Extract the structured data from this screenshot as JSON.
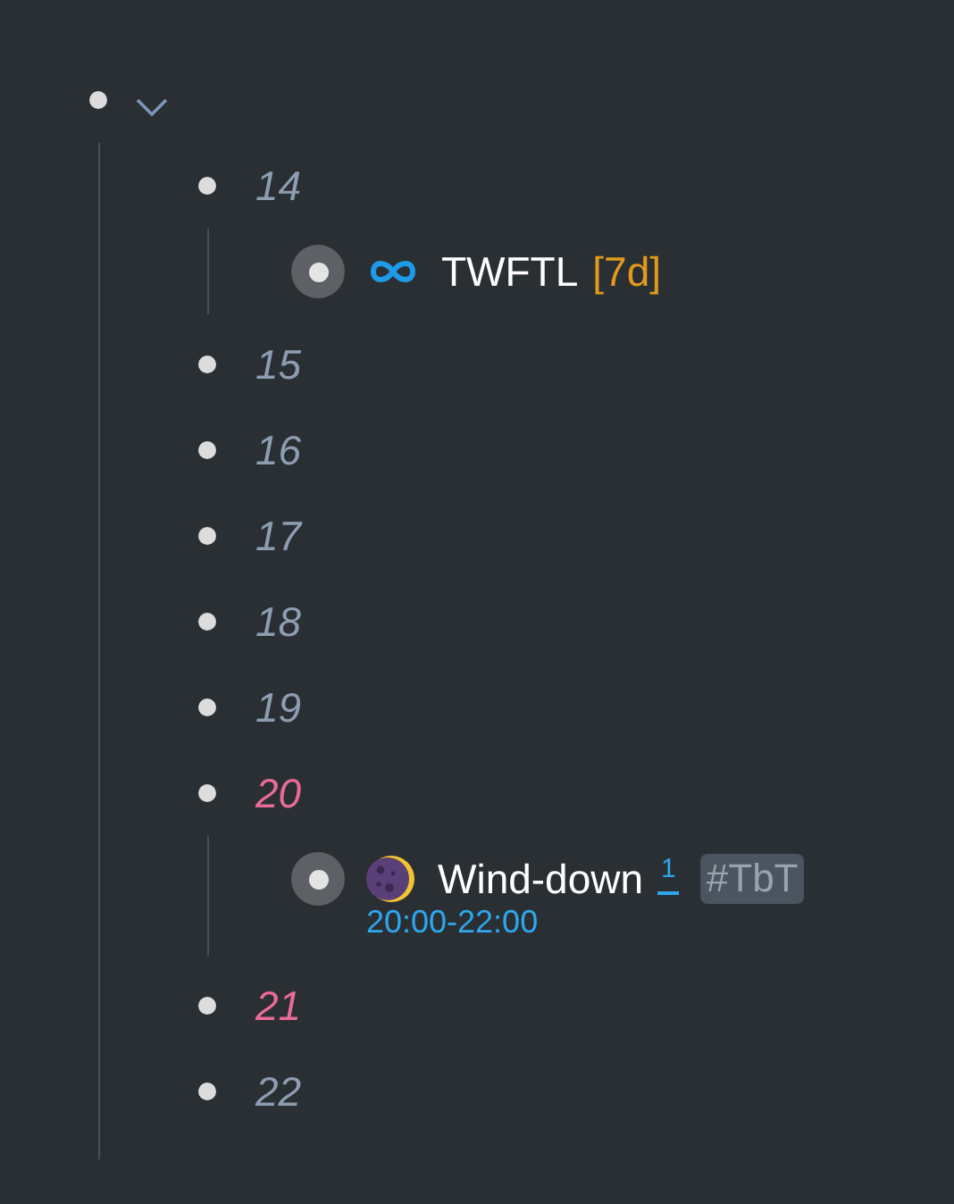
{
  "root": {
    "expanded": true,
    "children": [
      {
        "text": "14",
        "highlight": false,
        "children": [
          {
            "kind": "infinity",
            "text": "TWFTL",
            "duration": "[7d]",
            "collapsed": true
          }
        ]
      },
      {
        "text": "15",
        "highlight": false
      },
      {
        "text": "16",
        "highlight": false
      },
      {
        "text": "17",
        "highlight": false
      },
      {
        "text": "18",
        "highlight": false
      },
      {
        "text": "19",
        "highlight": false
      },
      {
        "text": "20",
        "highlight": true,
        "children": [
          {
            "kind": "moon",
            "text": "Wind-down",
            "footnote": "1",
            "tag": "#TbT",
            "time": "20:00-22:00",
            "collapsed": true
          }
        ]
      },
      {
        "text": "21",
        "highlight": true
      },
      {
        "text": "22",
        "highlight": false
      }
    ]
  }
}
